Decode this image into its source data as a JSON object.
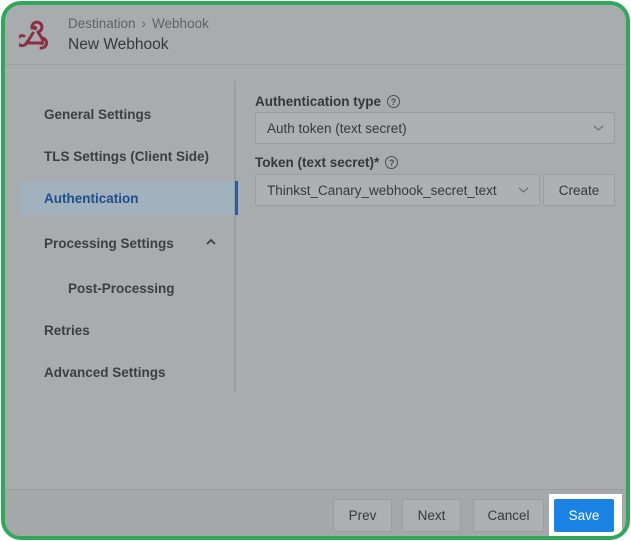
{
  "header": {
    "breadcrumb": [
      "Destination",
      "›",
      "Webhook"
    ],
    "title": "New Webhook",
    "logo_color": "#8c2f45"
  },
  "sidebar": {
    "items": [
      {
        "label": "General Settings"
      },
      {
        "label": "TLS Settings (Client Side)"
      },
      {
        "label": "Authentication",
        "active": true
      },
      {
        "label": "Processing Settings",
        "expanded": true
      },
      {
        "label": "Post-Processing"
      },
      {
        "label": "Retries"
      },
      {
        "label": "Advanced Settings"
      }
    ]
  },
  "form": {
    "auth_type": {
      "label": "Authentication type",
      "help": "?",
      "value": "Auth token (text secret)"
    },
    "token": {
      "label": "Token (text secret)*",
      "help": "?",
      "value": "Thinkst_Canary_webhook_secret_text",
      "create_label": "Create"
    }
  },
  "footer": {
    "prev_label": "Prev",
    "next_label": "Next",
    "cancel_label": "Cancel",
    "save_label": "Save"
  },
  "colors": {
    "frame_border": "#2fa85a",
    "overlay": "#a9acae",
    "save_button": "#1a82e2",
    "active_nav": "#1f4e8a"
  }
}
